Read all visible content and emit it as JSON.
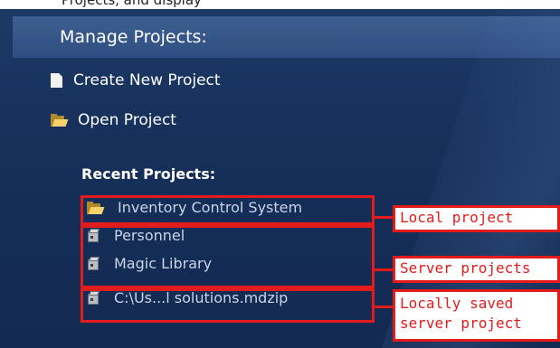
{
  "top_strip_text": "Projects, and display",
  "header": {
    "title": "Manage Projects:"
  },
  "actions": [
    {
      "label": "Create New Project",
      "icon": "document-icon"
    },
    {
      "label": "Open Project",
      "icon": "folder-open-icon"
    }
  ],
  "recent": {
    "heading": "Recent Projects:",
    "items": [
      {
        "label": "Inventory Control System",
        "icon": "folder-open-icon"
      },
      {
        "label": "Personnel",
        "icon": "server-project-icon"
      },
      {
        "label": "Magic Library",
        "icon": "server-project-icon"
      },
      {
        "label": "C:\\Us...l solutions.mdzip",
        "icon": "server-project-icon"
      }
    ]
  },
  "callouts": {
    "local": "Local project",
    "server": "Server projects",
    "saved_line1": "Locally saved",
    "saved_line2": "server project"
  },
  "colors": {
    "panel": "#16305a",
    "header_bar": "#2f4f82",
    "annotation_red": "#e41b1b"
  }
}
